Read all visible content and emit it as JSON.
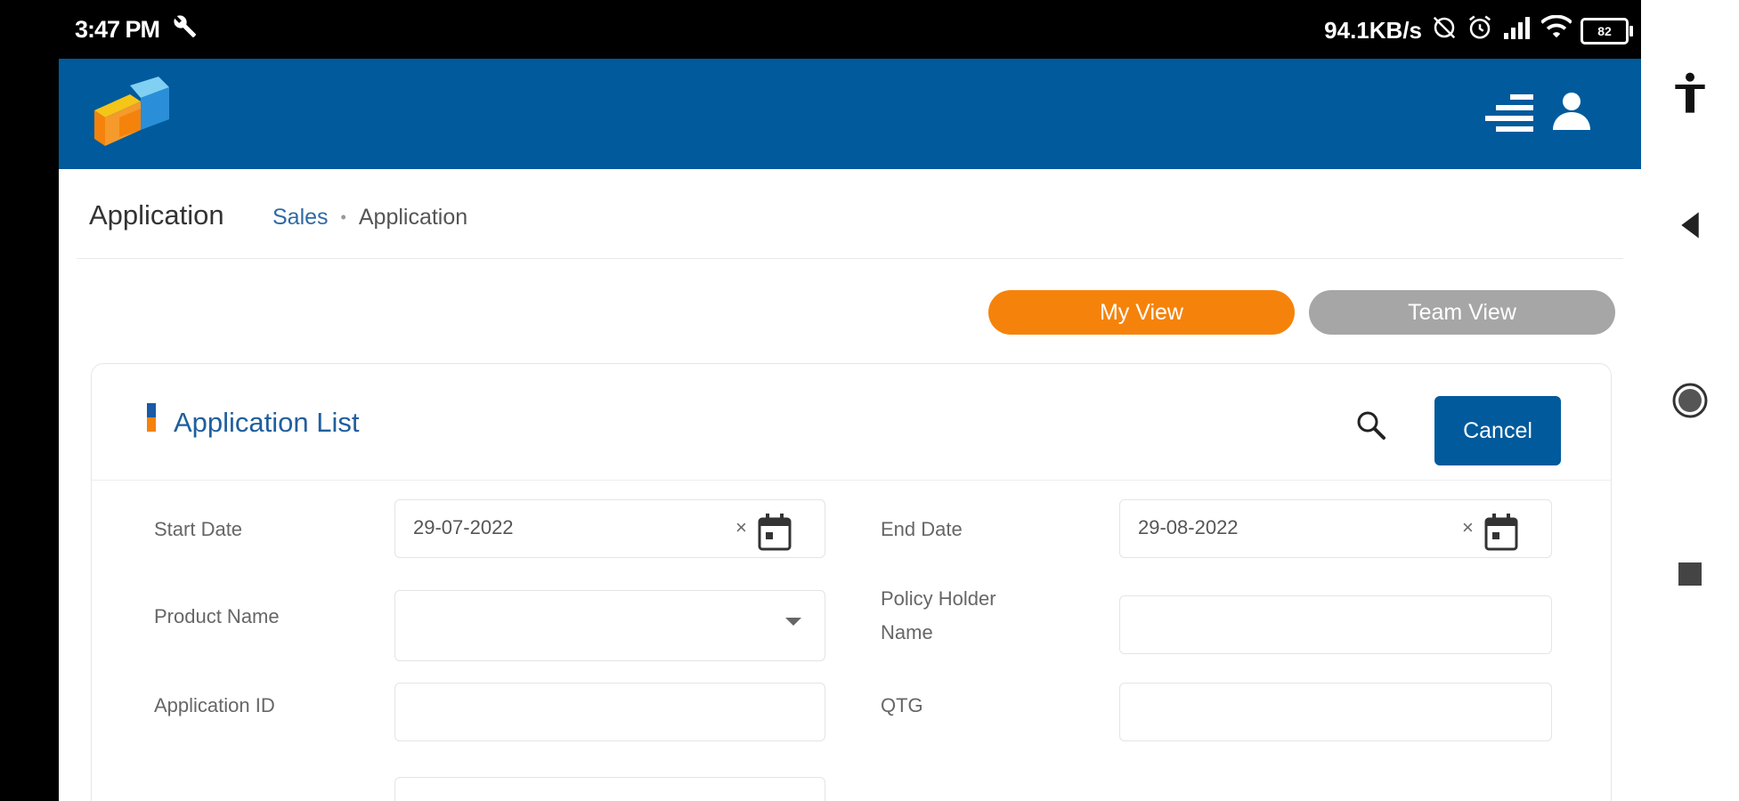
{
  "status_bar": {
    "time": "3:47 PM",
    "net_speed": "94.1KB/s",
    "battery": "82"
  },
  "header": {
    "logo_icon": "brand-cube-logo",
    "menu_icon": "menu-icon",
    "user_icon": "user-icon",
    "brand_colors": {
      "primary": "#005a9c",
      "accent": "#f5830b"
    }
  },
  "page": {
    "title": "Application",
    "breadcrumb": [
      "Sales",
      "Application"
    ]
  },
  "view_toggle": {
    "my_view": "My View",
    "team_view": "Team View",
    "active": "My View"
  },
  "card": {
    "title": "Application List",
    "cancel_label": "Cancel"
  },
  "filters": {
    "start_date": {
      "label": "Start Date",
      "value": "29-07-2022"
    },
    "end_date": {
      "label": "End Date",
      "value": "29-08-2022"
    },
    "product_name": {
      "label": "Product Name",
      "value": ""
    },
    "policy_holder_name": {
      "label_line1": "Policy Holder",
      "label_line2": "Name",
      "value": ""
    },
    "application_id": {
      "label": "Application ID",
      "value": ""
    },
    "qtg": {
      "label": "QTG",
      "value": ""
    }
  }
}
